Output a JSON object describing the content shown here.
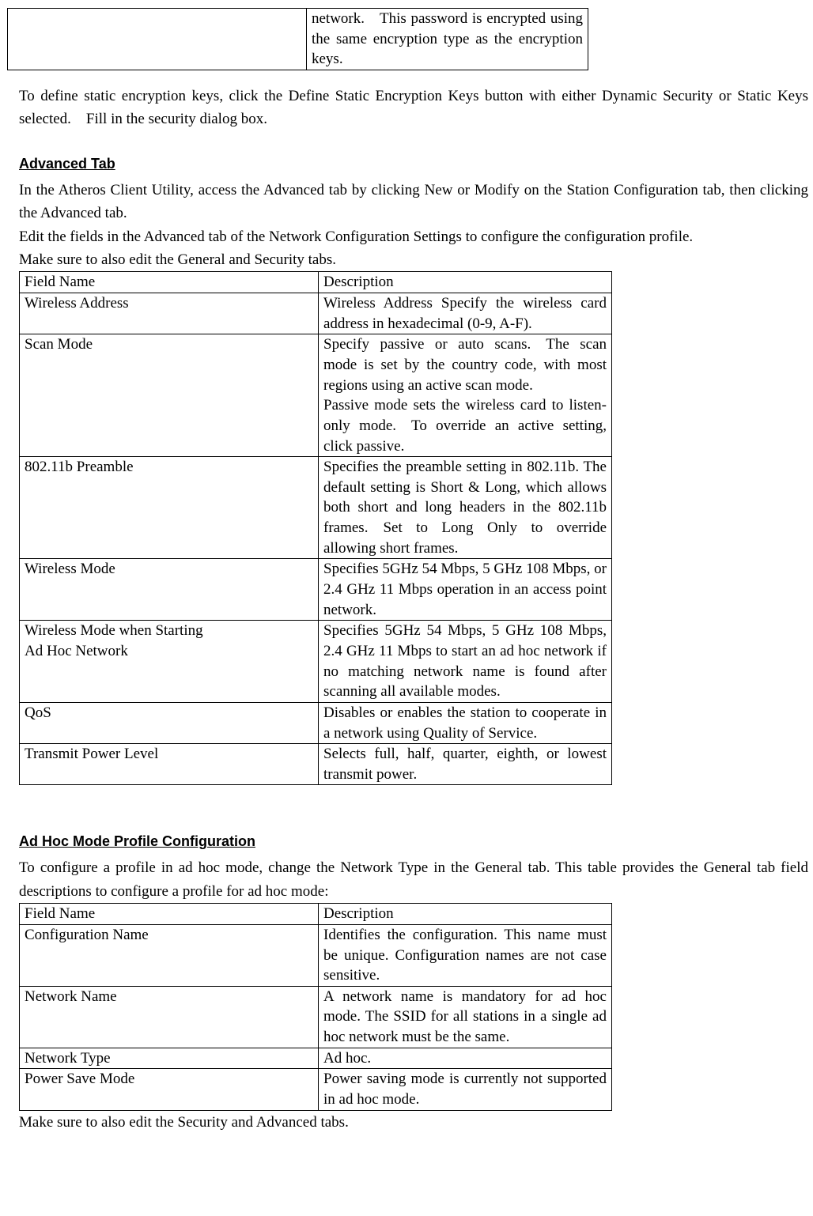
{
  "top_table": {
    "partial_cell": "network. This password is encrypted using the same encryption type as the encryption keys."
  },
  "para1": "To define static encryption keys, click the Define Static Encryption Keys button with either Dynamic Security or Static Keys selected. Fill in the security dialog box.",
  "heading1": "Advanced Tab",
  "para2_l1": "In the Atheros Client Utility, access the Advanced tab by clicking New or Modify on the Station Configuration tab, then clicking the Advanced tab.",
  "para2_l2": "Edit the fields in the Advanced tab of the Network Configuration Settings to configure the configuration profile.",
  "para2_l3": "Make sure to also edit the General and Security tabs.",
  "adv_table": {
    "header_col1": "Field Name",
    "header_col2": "Description",
    "rows": [
      {
        "f": "Wireless Address",
        "d": "Wireless Address Specify the wireless card address in hexadecimal (0-9, A-F)."
      },
      {
        "f": "Scan Mode",
        "d": "Specify passive or auto scans. The scan mode is set by the country code, with most regions using an active scan mode.\nPassive mode sets the wireless card to listen-only mode. To override an active setting, click passive."
      },
      {
        "f": "802.11b Preamble",
        "d": "Specifies the preamble setting in 802.11b. The default setting is Short & Long, which allows both short and long headers in the 802.11b frames. Set to Long Only to override allowing short frames."
      },
      {
        "f": "Wireless Mode",
        "d": "Specifies 5GHz 54 Mbps, 5 GHz 108 Mbps, or 2.4 GHz 11 Mbps operation in an access point network."
      },
      {
        "f": "Wireless Mode when Starting\nAd Hoc Network",
        "d": "Specifies 5GHz 54 Mbps, 5 GHz 108 Mbps, 2.4 GHz 11 Mbps to start an ad hoc network if no matching network name is found after scanning all available modes."
      },
      {
        "f": "QoS",
        "d": "Disables or enables the station to cooperate in a network using Quality of Service."
      },
      {
        "f": "Transmit Power Level",
        "d": "Selects full, half, quarter, eighth, or lowest transmit power."
      }
    ]
  },
  "heading2": "Ad Hoc Mode Profile Configuration",
  "para3": "To configure a profile in ad hoc mode, change the Network Type in the General tab. This table provides the General tab field descriptions to configure a profile for ad hoc mode:",
  "adhoc_table": {
    "header_col1": "Field Name",
    "header_col2": "Description",
    "rows": [
      {
        "f": "Configuration Name",
        "d": "Identifies the configuration. This name must be unique. Configuration names are not case sensitive."
      },
      {
        "f": "Network Name",
        "d": "A network name is mandatory for ad hoc mode. The SSID for all stations in a single ad hoc network must be the same."
      },
      {
        "f": "Network Type",
        "d": "Ad hoc."
      },
      {
        "f": "Power Save Mode",
        "d": "Power saving mode is currently not supported in ad hoc mode."
      }
    ]
  },
  "para4": "Make sure to also edit the Security and Advanced tabs."
}
